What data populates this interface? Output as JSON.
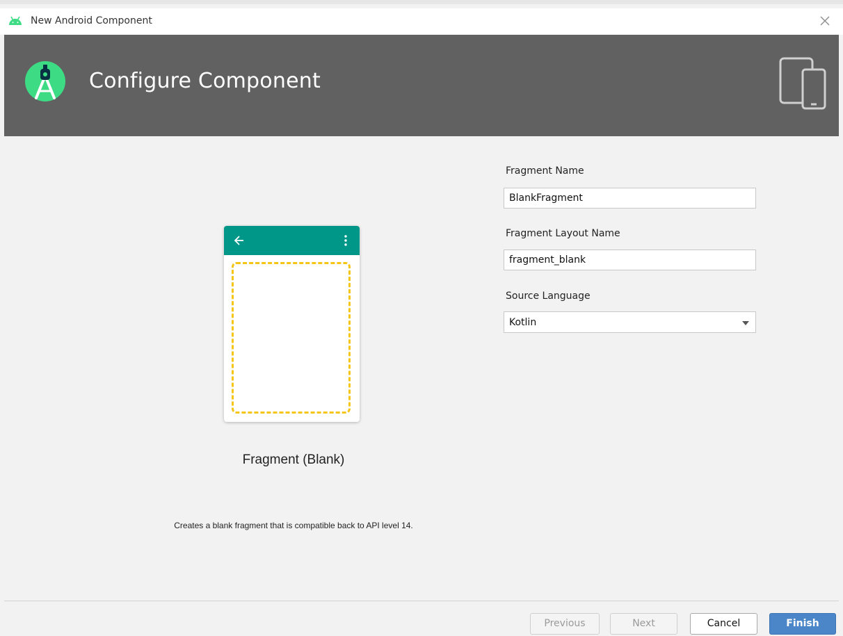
{
  "window": {
    "title": "New Android Component"
  },
  "header": {
    "heading": "Configure Component",
    "logo_icon": "android-studio-logo-icon",
    "devices_icon": "devices-icon",
    "background": "#616161"
  },
  "preview": {
    "name": "Fragment (Blank)",
    "description": "Creates a blank fragment that is compatible back to API level 14.",
    "appbar_color": "#009688",
    "dashed_color": "#f5c518"
  },
  "form": {
    "fragment_name": {
      "label": "Fragment Name",
      "value": "BlankFragment"
    },
    "layout_name": {
      "label": "Fragment Layout Name",
      "value": "fragment_blank"
    },
    "source_language": {
      "label": "Source Language",
      "value": "Kotlin"
    }
  },
  "buttons": {
    "previous": "Previous",
    "next": "Next",
    "cancel": "Cancel",
    "finish": "Finish"
  },
  "colors": {
    "primary_button": "#4a86c8"
  }
}
